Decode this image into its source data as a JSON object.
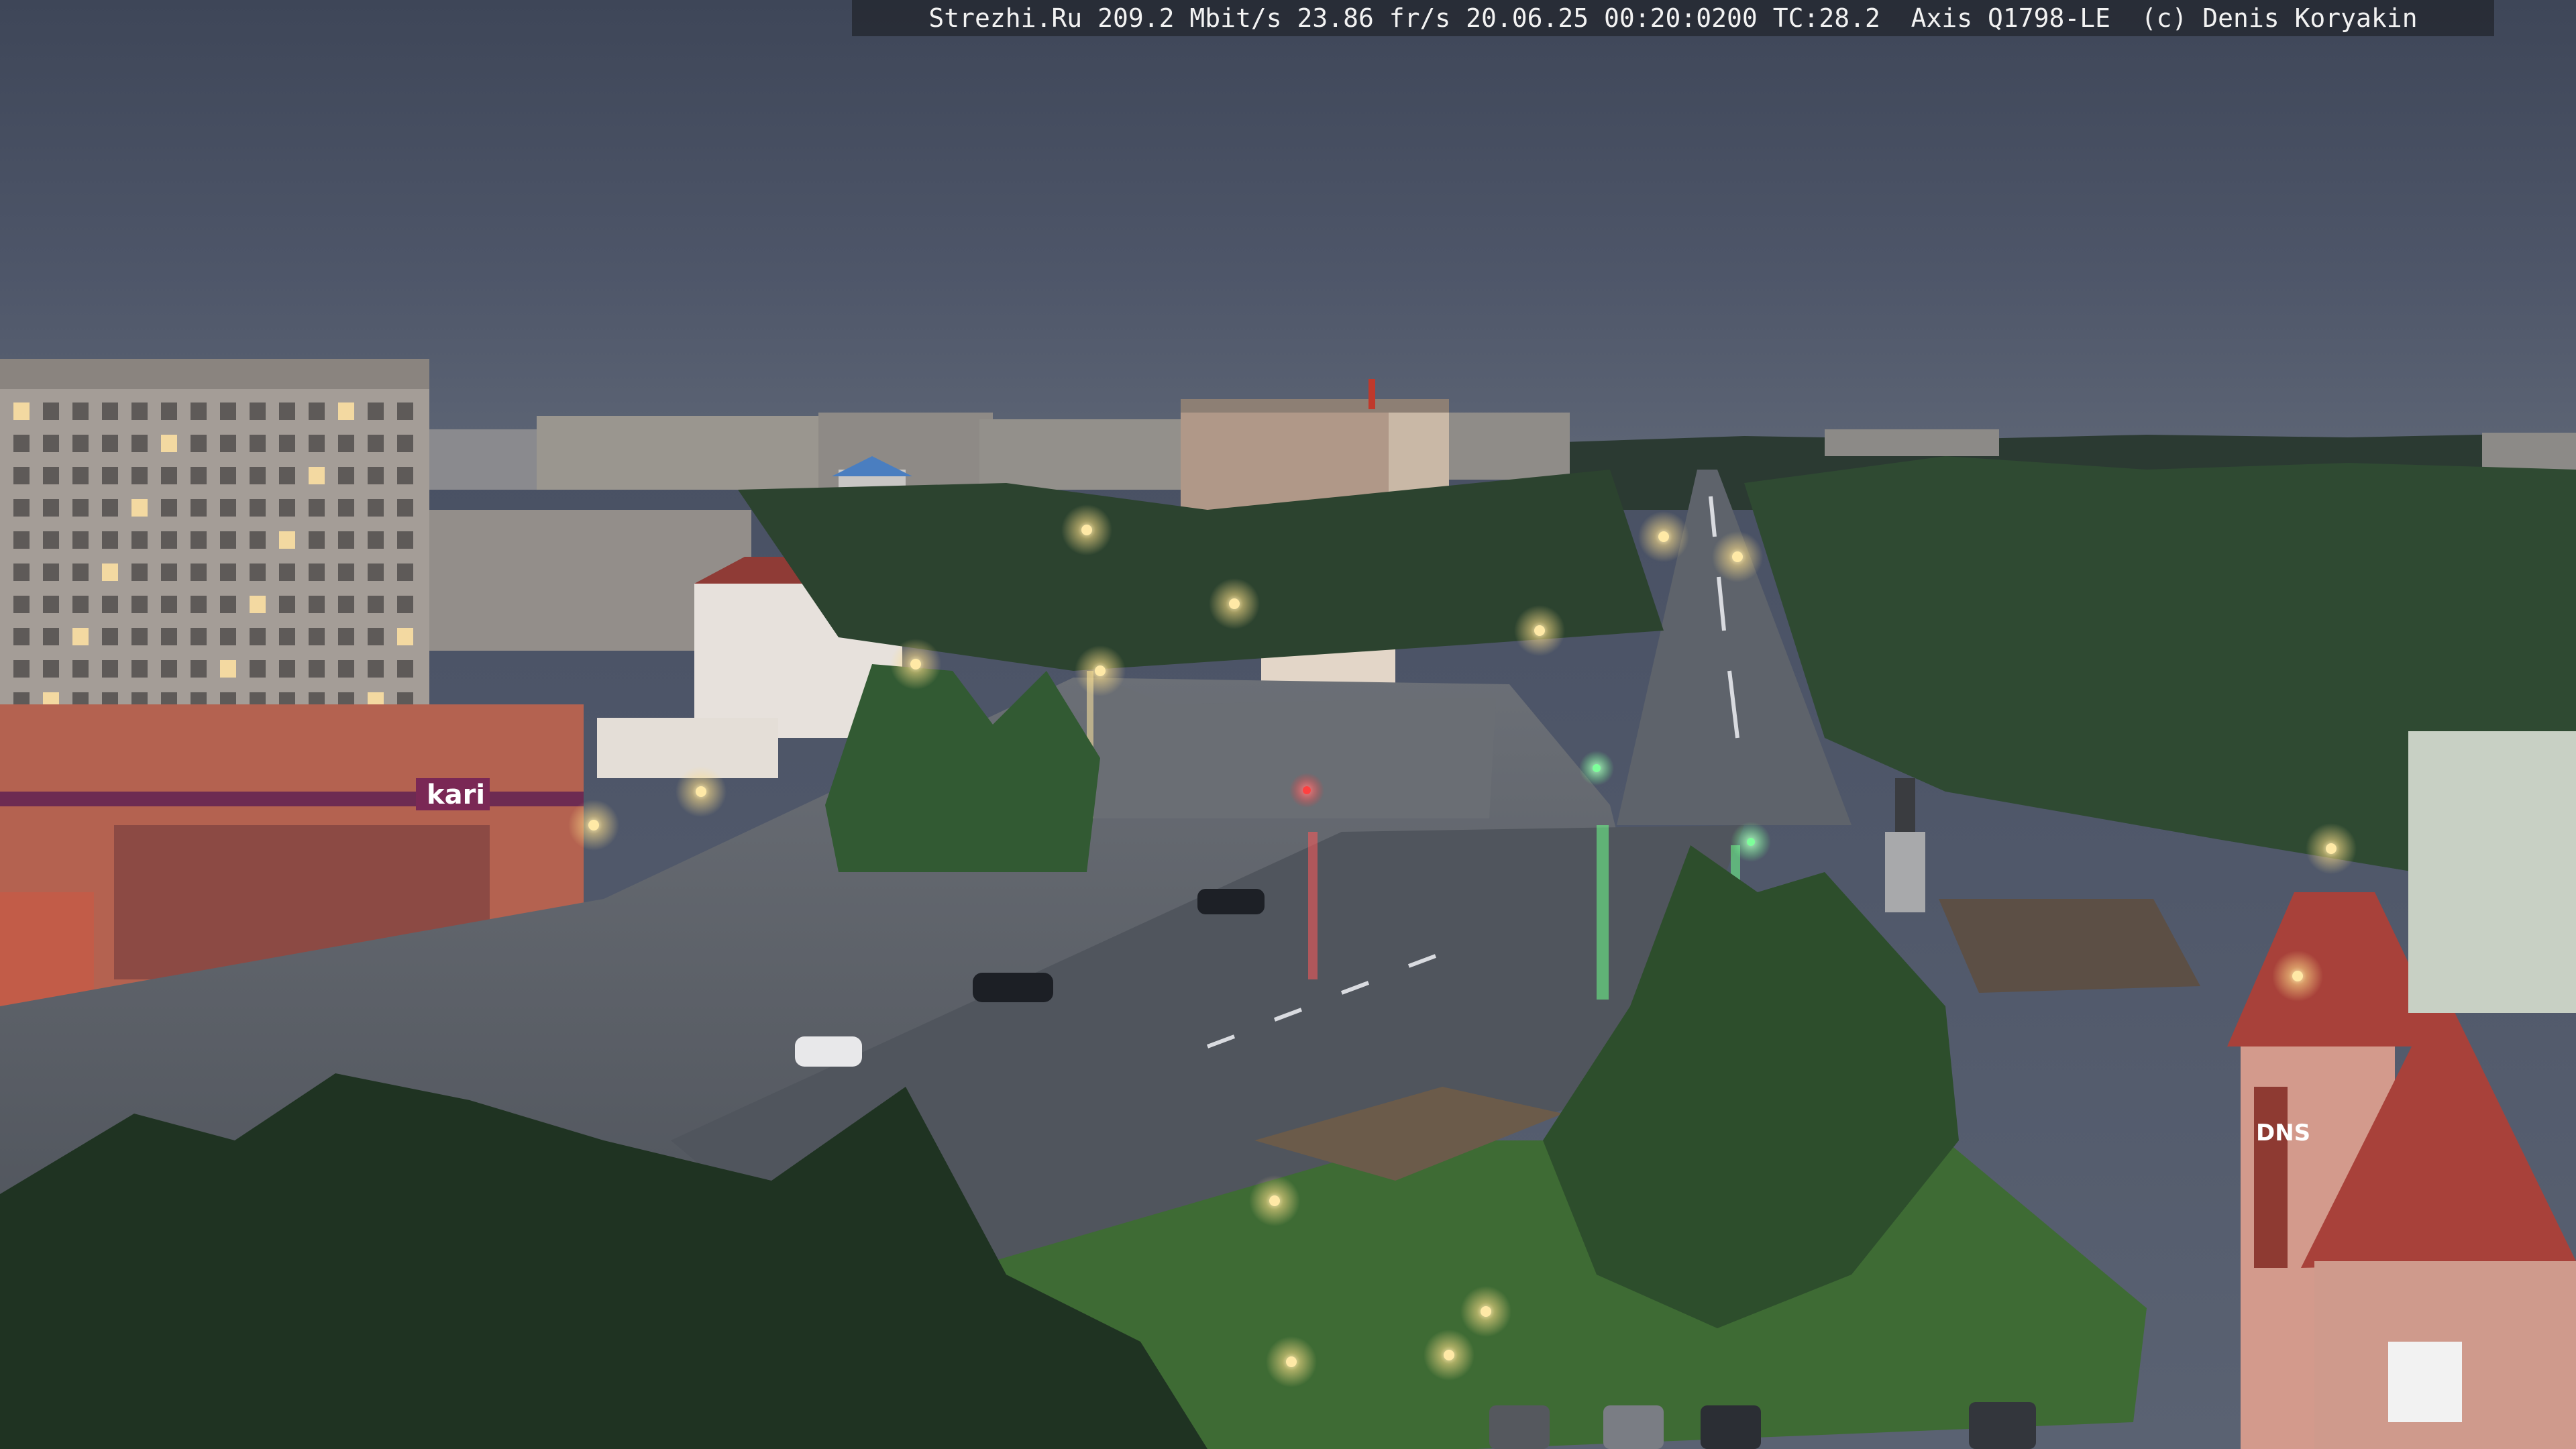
{
  "camera_overlay": {
    "text": "Strezhi.Ru 209.2 Mbit/s 23.86 fr/s 20.06.25 00:20:0200 TC:28.2  Axis Q1798-LE  (c) Denis Koryakin"
  },
  "signage": {
    "shop_sign": "kari",
    "store_sign_right": "DNS"
  },
  "colors": {
    "sky": "#4b5366",
    "foliage": "#2f4a32",
    "asphalt_wet": "#555a62",
    "building_brick": "#b46250",
    "roof_red": "#a8413a",
    "street_light": "#ffe9a6"
  }
}
